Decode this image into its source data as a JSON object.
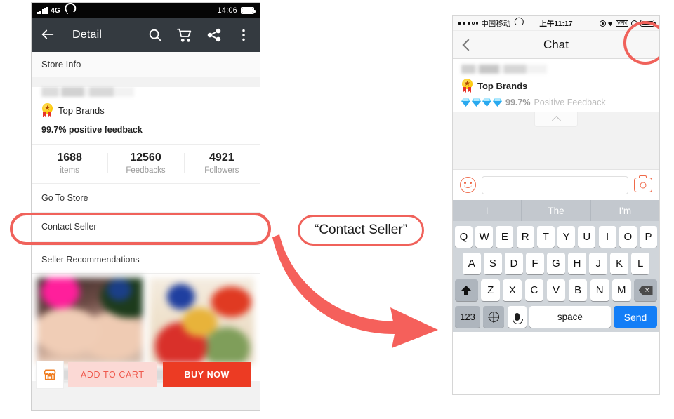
{
  "left_phone": {
    "status_bar": {
      "network": "4G",
      "time": "14:06",
      "signal_icon": "signal-bars-icon",
      "wifi_icon": "wifi-icon",
      "battery_icon": "battery-icon"
    },
    "app_bar": {
      "back_icon": "back-arrow-icon",
      "title": "Detail",
      "actions": [
        "search-icon",
        "cart-icon",
        "share-icon",
        "more-vertical-icon"
      ]
    },
    "store_info": {
      "section_title": "Store Info",
      "brand_badge_icon": "top-brands-medal-icon",
      "brand_label": "Top Brands",
      "feedback": "99.7% positive feedback",
      "stats": [
        {
          "value": "1688",
          "label": "items"
        },
        {
          "value": "12560",
          "label": "Feedbacks"
        },
        {
          "value": "4921",
          "label": "Followers"
        }
      ],
      "rows": [
        "Go To Store",
        "Contact Seller"
      ]
    },
    "recommendations": {
      "title": "Seller Recommendations"
    },
    "bottom_bar": {
      "store_icon": "storefront-icon",
      "add_to_cart": "ADD TO CART",
      "buy_now": "BUY NOW"
    }
  },
  "annotation": {
    "callout_text": "“Contact Seller”",
    "arrow_icon": "curved-arrow-icon",
    "highlight_color": "#f0625b"
  },
  "right_phone": {
    "status_bar": {
      "signal_dots": "signal-dots-icon",
      "carrier": "中国移动",
      "wifi_icon": "wifi-icon",
      "time": "上午11:17",
      "icons": [
        "lock-rotation-icon",
        "location-arrow-icon",
        "vpn-icon",
        "alarm-icon",
        "battery-icon"
      ],
      "vpn_label": "VPN"
    },
    "nav_bar": {
      "back_icon": "chevron-left-icon",
      "title": "Chat"
    },
    "seller_header": {
      "brand_badge_icon": "top-brands-medal-icon",
      "brand_label": "Top Brands",
      "diamond_icon": "diamond-rating-icon",
      "diamond_count": 4,
      "feedback_pct": "99.7%",
      "feedback_label": "Positive Feedback",
      "collapse_icon": "chevron-up-icon"
    },
    "input_bar": {
      "emoji_icon": "emoji-smiley-icon",
      "input_value": "",
      "input_placeholder": "",
      "camera_icon": "camera-icon"
    },
    "keyboard": {
      "suggestions": [
        "I",
        "The",
        "I'm"
      ],
      "row1": [
        "Q",
        "W",
        "E",
        "R",
        "T",
        "Y",
        "U",
        "I",
        "O",
        "P"
      ],
      "row2": [
        "A",
        "S",
        "D",
        "F",
        "G",
        "H",
        "J",
        "K",
        "L"
      ],
      "row3_letters": [
        "Z",
        "X",
        "C",
        "V",
        "B",
        "N",
        "M"
      ],
      "shift_icon": "shift-icon",
      "delete_icon": "backspace-icon",
      "numbers_key": "123",
      "globe_icon": "globe-icon",
      "mic_icon": "microphone-icon",
      "space_key": "space",
      "send_key": "Send"
    }
  }
}
